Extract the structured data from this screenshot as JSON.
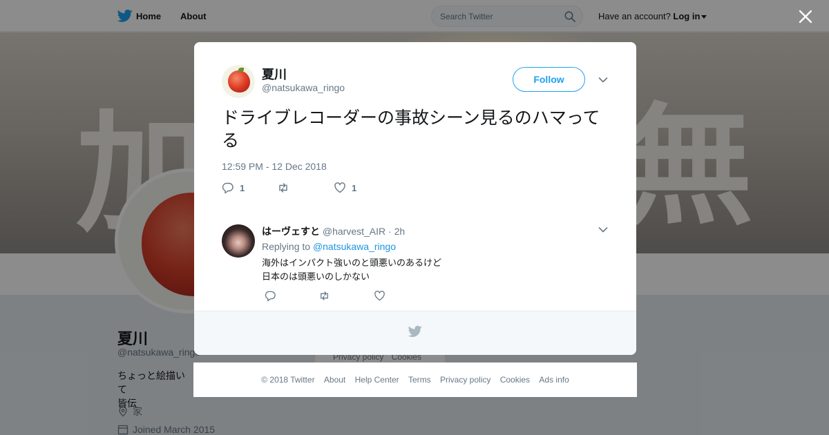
{
  "nav": {
    "home_label": "Home",
    "about_label": "About",
    "search_placeholder": "Search Twitter",
    "have_account": "Have an account?",
    "login_label": "Log in"
  },
  "banner": {
    "glyph_left": "加",
    "glyph_right": "無"
  },
  "profile": {
    "name": "夏川",
    "handle": "@natsukawa_ringo",
    "bio_line1": "ちょっと絵描いて",
    "bio_line2": "皆伝",
    "location": "家",
    "joined": "Joined March 2015"
  },
  "side_links": [
    "Privacy policy",
    "Cookies"
  ],
  "tweet": {
    "author_name": "夏川",
    "author_handle": "@natsukawa_ringo",
    "follow_label": "Follow",
    "text": "ドライブレコーダーの事故シーン見るのハマってる",
    "timestamp": "12:59 PM - 12 Dec 2018",
    "reply_count": "1",
    "like_count": "1"
  },
  "reply": {
    "author_name": "はーヴェすと",
    "author_handle": "@harvest_AIR",
    "separator": "·",
    "age": "2h",
    "replying_prefix": "Replying to",
    "replying_to": "@natsukawa_ringo",
    "text_line1": "海外はインパクト強いのと頭悪いのあるけど",
    "text_line2": "日本のは頭悪いのしかない"
  },
  "footer_links": [
    "© 2018 Twitter",
    "About",
    "Help Center",
    "Terms",
    "Privacy policy",
    "Cookies",
    "Ads info"
  ],
  "colors": {
    "brand": "#1da1f2",
    "link": "#1b95e0",
    "secondary_text": "#657786"
  },
  "icons": {
    "logo": "twitter-bird-icon",
    "search": "search-icon",
    "close": "close-icon",
    "more": "chevron-down-icon",
    "reply": "reply-icon",
    "retweet": "retweet-icon",
    "like": "heart-icon",
    "location": "location-pin-icon",
    "calendar": "calendar-icon"
  }
}
